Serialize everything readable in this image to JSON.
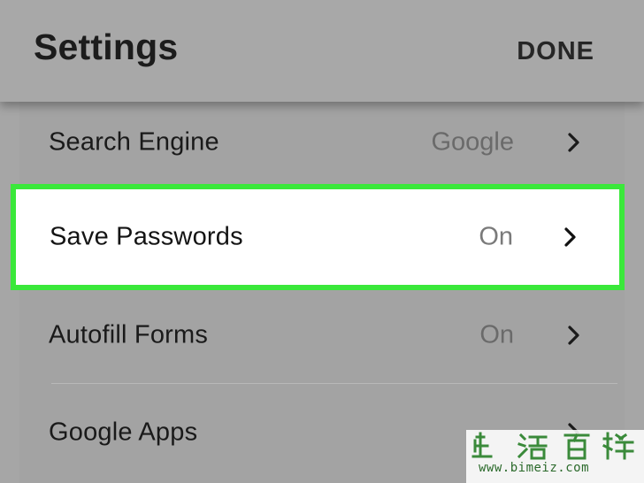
{
  "header": {
    "title": "Settings",
    "done_label": "DONE"
  },
  "settings": [
    {
      "label": "Search Engine",
      "value": "Google",
      "highlighted": false
    },
    {
      "label": "Save Passwords",
      "value": "On",
      "highlighted": true
    },
    {
      "label": "Autofill Forms",
      "value": "On",
      "highlighted": false
    },
    {
      "label": "Google Apps",
      "value": "",
      "highlighted": false
    }
  ],
  "watermark": {
    "logo_text": "生活百科",
    "url": "www.bimeiz.com"
  },
  "colors": {
    "highlight_border": "#3ae83a",
    "overlay_gray": "#a6a6a6",
    "watermark_green": "#2b6a2b"
  }
}
